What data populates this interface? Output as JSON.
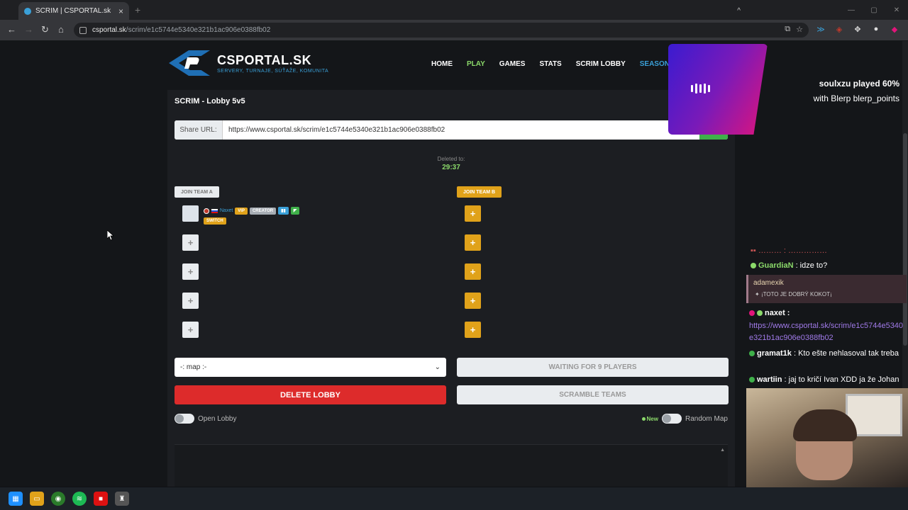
{
  "browser": {
    "tab_title": "SCRIM | CSPORTAL.sk",
    "url_domain": "csportal.sk",
    "url_path": "/scrim/e1c5744e5340e321b1ac906e0388fb02"
  },
  "site": {
    "logo_title": "CSPORTAL.SK",
    "logo_subtitle": "SERVERY, TURNAJE, SÚŤAŽE, KOMUNITA",
    "nav": [
      "HOME",
      "PLAY",
      "GAMES",
      "STATS",
      "SCRIM LOBBY",
      "SEASONS"
    ]
  },
  "lobby": {
    "title": "SCRIM - Lobby 5v5",
    "share_label": "Share URL:",
    "share_url": "https://www.csportal.sk/scrim/e1c5744e5340e321b1ac906e0388fb02",
    "deleted_label": "Deleted to:",
    "timer": "29:37",
    "join_a": "JOIN TEAM A",
    "join_b": "JOIN TEAM B",
    "player": {
      "name": "Naxet",
      "badges": [
        "VIP",
        "CREATOR"
      ],
      "switch": "SWITCH"
    },
    "map_select": "-: map :-",
    "waiting": "WAITING FOR 9 PLAYERS",
    "delete": "DELETE LOBBY",
    "scramble": "SCRAMBLE TEAMS",
    "open_lobby": "Open Lobby",
    "new_tag": "New",
    "random_map": "Random Map"
  },
  "overlay": {
    "line1": "soulxzu played 60%",
    "line2": "with Blerp blerp_points"
  },
  "chat": {
    "guardian_name": "GuardiaN",
    "guardian_msg": " : idze to?",
    "adam_name": "adamexik",
    "adam_msg": "¡TOTO JE DOBRÝ KOKOT¡",
    "naxet_name": "naxet :",
    "naxet_link": "https://www.csportal.sk/scrim/e1c5744e5340e321b1ac906e0388fb02",
    "gramat_name": "gramat1k",
    "gramat_msg": " : Kto ešte nehlasoval tak treba",
    "wartin_name": "wartiin",
    "wartin_msg": " : jaj to kričí Ivan XDD ja že Johan"
  }
}
